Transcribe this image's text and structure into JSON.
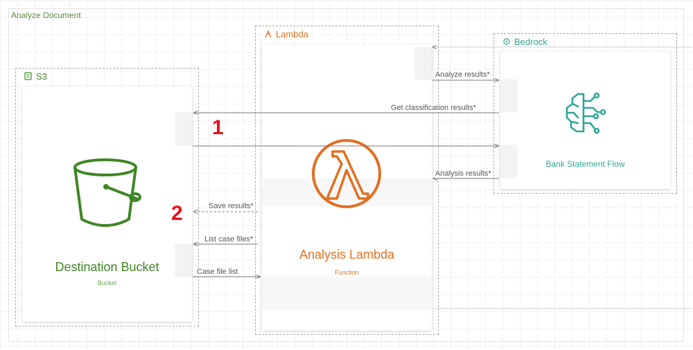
{
  "canvas": {
    "title": "Analyze Document"
  },
  "groups": {
    "s3": {
      "title": "S3",
      "color": "#3f8624"
    },
    "lambda": {
      "title": "Lambda",
      "color": "#e07020"
    },
    "bedrock": {
      "title": "Bedrock",
      "color": "#2ea597"
    }
  },
  "nodes": {
    "bucket": {
      "title": "Destination Bucket",
      "subtitle": "Bucket",
      "icon": "s3-bucket-icon"
    },
    "function": {
      "title": "Analysis Lambda",
      "subtitle": "Function",
      "icon": "lambda-icon"
    },
    "flow": {
      "title": "Bank Statement Flow",
      "icon": "bedrock-brain-icon"
    }
  },
  "connectors": [
    {
      "label": "Analyze results*"
    },
    {
      "label": "Get classification results*"
    },
    {
      "label": "Analysis results*"
    },
    {
      "label": "Save results*"
    },
    {
      "label": "List case files*"
    },
    {
      "label": "Case file list"
    }
  ],
  "markers": [
    "1",
    "2"
  ]
}
